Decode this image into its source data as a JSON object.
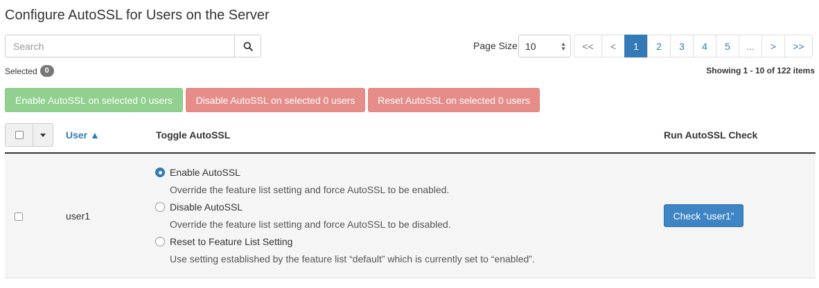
{
  "page": {
    "title": "Configure AutoSSL for Users on the Server"
  },
  "search": {
    "placeholder": "Search",
    "value": "",
    "icon": "search-icon"
  },
  "page_size": {
    "label": "Page Size",
    "value": "10"
  },
  "pagination": {
    "items": [
      {
        "label": "<<",
        "state": "disabled"
      },
      {
        "label": "<",
        "state": "disabled"
      },
      {
        "label": "1",
        "state": "active"
      },
      {
        "label": "2",
        "state": "normal"
      },
      {
        "label": "3",
        "state": "normal"
      },
      {
        "label": "4",
        "state": "normal"
      },
      {
        "label": "5",
        "state": "normal"
      },
      {
        "label": "...",
        "state": "normal"
      },
      {
        "label": ">",
        "state": "normal"
      },
      {
        "label": ">>",
        "state": "normal"
      }
    ]
  },
  "selection": {
    "label": "Selected",
    "count": "0"
  },
  "showing": "Showing 1 - 10 of 122 items",
  "actions": {
    "enable": "Enable AutoSSL on selected 0 users",
    "disable": "Disable AutoSSL on selected 0 users",
    "reset": "Reset AutoSSL on selected 0 users"
  },
  "table": {
    "headers": {
      "user": "User ▲",
      "toggle": "Toggle AutoSSL",
      "run": "Run AutoSSL Check"
    },
    "rows": [
      {
        "user": "user1",
        "selected": false,
        "options": [
          {
            "label": "Enable AutoSSL",
            "desc": "Override the feature list setting and force AutoSSL to be enabled.",
            "checked": true
          },
          {
            "label": "Disable AutoSSL",
            "desc": "Override the feature list setting and force AutoSSL to be disabled.",
            "checked": false
          },
          {
            "label": "Reset to Feature List Setting",
            "desc": "Use setting established by the feature list “default” which is currently set to “enabled”.",
            "checked": false
          }
        ],
        "check_button": "Check “user1”"
      }
    ]
  },
  "colors": {
    "primary": "#337ab7",
    "success_light": "#92d08f",
    "danger_light": "#e68d89",
    "badge": "#777777"
  }
}
